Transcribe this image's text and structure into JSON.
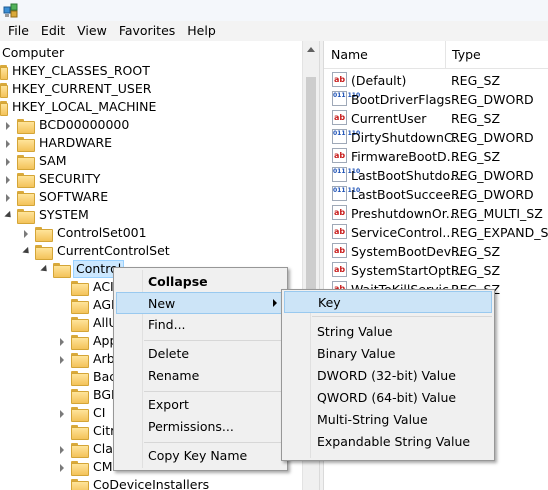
{
  "menubar": {
    "items": [
      "File",
      "Edit",
      "View",
      "Favorites",
      "Help"
    ]
  },
  "tree": {
    "root_label": "Computer",
    "nodes": [
      {
        "label": "HKEY_CLASSES_ROOT"
      },
      {
        "label": "HKEY_CURRENT_USER"
      },
      {
        "label": "HKEY_LOCAL_MACHINE"
      },
      {
        "label": "BCD00000000"
      },
      {
        "label": "HARDWARE"
      },
      {
        "label": "SAM"
      },
      {
        "label": "SECURITY"
      },
      {
        "label": "SOFTWARE"
      },
      {
        "label": "SYSTEM"
      },
      {
        "label": "ControlSet001"
      },
      {
        "label": "CurrentControlSet"
      },
      {
        "label": "Control"
      },
      {
        "label": "ACI"
      },
      {
        "label": "AGI"
      },
      {
        "label": "AllU"
      },
      {
        "label": "App"
      },
      {
        "label": "Arb"
      },
      {
        "label": "Bac"
      },
      {
        "label": "BGF"
      },
      {
        "label": "CI"
      },
      {
        "label": "Citr"
      },
      {
        "label": "Cla"
      },
      {
        "label": "CM"
      },
      {
        "label": "CoDeviceInstallers"
      }
    ]
  },
  "values": {
    "columns": {
      "name": "Name",
      "type": "Type"
    },
    "rows": [
      {
        "icon": "ab",
        "name": "(Default)",
        "type": "REG_SZ"
      },
      {
        "icon": "dw",
        "name": "BootDriverFlags",
        "type": "REG_DWORD"
      },
      {
        "icon": "ab",
        "name": "CurrentUser",
        "type": "REG_SZ"
      },
      {
        "icon": "dw",
        "name": "DirtyShutdownC...",
        "type": "REG_DWORD"
      },
      {
        "icon": "ab",
        "name": "FirmwareBootD...",
        "type": "REG_SZ"
      },
      {
        "icon": "dw",
        "name": "LastBootShutdo...",
        "type": "REG_DWORD"
      },
      {
        "icon": "dw",
        "name": "LastBootSuccee...",
        "type": "REG_DWORD"
      },
      {
        "icon": "ab",
        "name": "PreshutdownOr...",
        "type": "REG_MULTI_SZ"
      },
      {
        "icon": "ab",
        "name": "ServiceControl...",
        "type": "REG_EXPAND_SZ"
      },
      {
        "icon": "ab",
        "name": "SystemBootDevi...",
        "type": "REG_SZ"
      },
      {
        "icon": "ab",
        "name": "SystemStartOpti...",
        "type": "REG_SZ"
      },
      {
        "icon": "ab",
        "name": "WaitToKillServic...",
        "type": "REG_SZ"
      }
    ]
  },
  "context_menu": {
    "items": [
      "Collapse",
      "New",
      "Find...",
      "Delete",
      "Rename",
      "Export",
      "Permissions...",
      "Copy Key Name"
    ]
  },
  "submenu": {
    "items": [
      "Key",
      "String Value",
      "Binary Value",
      "DWORD (32-bit) Value",
      "QWORD (64-bit) Value",
      "Multi-String Value",
      "Expandable String Value"
    ]
  },
  "icons": {
    "app": "registry-editor-icon",
    "folder": "folder-icon",
    "string_value": "string-value-icon",
    "binary_value": "binary-value-icon"
  },
  "colors": {
    "selection": "#cce8ff",
    "menu_highlight": "#cce4f7",
    "folder": "#f3c25a"
  }
}
